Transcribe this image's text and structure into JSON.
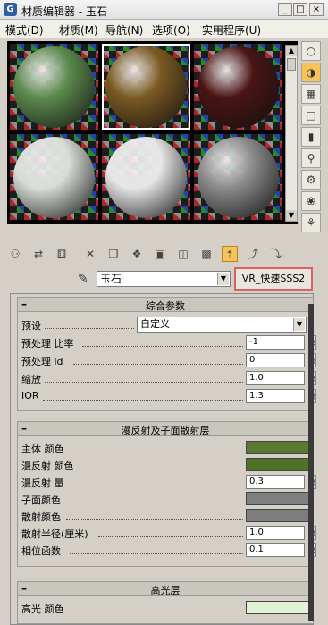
{
  "window": {
    "title": "材质编辑器 - 玉石",
    "controls": [
      "_",
      "□",
      "×"
    ]
  },
  "menu": [
    "模式(D)",
    "材质(M)",
    "导航(N)",
    "选项(O)",
    "实用程序(U)"
  ],
  "slots": [
    {
      "material": "green",
      "color": "#5c8a4e",
      "selected": false
    },
    {
      "material": "checker-glass",
      "color": "#7a5a22",
      "selected": true
    },
    {
      "material": "dark-red",
      "color": "#4a1414",
      "selected": false
    },
    {
      "material": "white-1",
      "color": "#d8ddd8",
      "selected": false
    },
    {
      "material": "white-2",
      "color": "#e6e6e6",
      "selected": false
    },
    {
      "material": "gray",
      "color": "#8a8a8a",
      "selected": false
    }
  ],
  "tools_right": [
    {
      "icon": "sample-type-icon",
      "glyph": "○",
      "active": false
    },
    {
      "icon": "backlight-icon",
      "glyph": "◑",
      "active": true
    },
    {
      "icon": "background-icon",
      "glyph": "▦",
      "active": false
    },
    {
      "icon": "uv-tiling-icon",
      "glyph": "□",
      "active": false
    },
    {
      "icon": "video-color-check-icon",
      "glyph": "▮",
      "active": false
    },
    {
      "icon": "make-preview-icon",
      "glyph": "⚲",
      "active": false
    },
    {
      "icon": "options-icon",
      "glyph": "⚙",
      "active": false
    },
    {
      "icon": "select-by-material-icon",
      "glyph": "❀",
      "active": false
    },
    {
      "icon": "material-navigator-icon",
      "glyph": "⚘",
      "active": false
    }
  ],
  "toolbar": [
    {
      "icon": "get-material-icon",
      "glyph": "⚇",
      "active": false
    },
    {
      "icon": "put-to-scene-icon",
      "glyph": "⇄",
      "active": false
    },
    {
      "icon": "assign-to-selection-icon",
      "glyph": "⚅",
      "active": false
    },
    {
      "icon": "reset-map-icon",
      "glyph": "✕",
      "active": false
    },
    {
      "icon": "copy-material-icon",
      "glyph": "❐",
      "active": false
    },
    {
      "icon": "make-unique-icon",
      "glyph": "❖",
      "active": false
    },
    {
      "icon": "put-to-library-icon",
      "glyph": "▣",
      "active": false
    },
    {
      "icon": "material-id-icon",
      "glyph": "◫",
      "active": false
    },
    {
      "icon": "show-map-icon",
      "glyph": "▩",
      "active": false
    },
    {
      "icon": "show-end-result-icon",
      "glyph": "⇡",
      "active": true
    },
    {
      "icon": "go-to-parent-icon",
      "glyph": "⤴",
      "active": false
    },
    {
      "icon": "go-forward-sibling-icon",
      "glyph": "⤵",
      "active": false
    }
  ],
  "material": {
    "name": "玉石",
    "type": "VR_快速SSS2"
  },
  "rollouts": {
    "general": {
      "collapse": "–",
      "title": "综合参数",
      "preset_label": "预设",
      "preset_value": "自定义",
      "prepass_rate_label": "预处理 比率",
      "prepass_rate": "-1",
      "prepass_id_label": "预处理 id",
      "prepass_id": "0",
      "scale_label": "缩放",
      "scale": "1.0",
      "ior_label": "IOR",
      "ior": "1.3"
    },
    "diffuse": {
      "collapse": "–",
      "title": "漫反射及子面散射层",
      "overall_color_label": "主体 颜色",
      "overall_color": "#5a7a30",
      "diffuse_color_label": "漫反射 颜色",
      "diffuse_color": "#4e7226",
      "diffuse_amount_label": "漫反射 量",
      "diffuse_amount": "0.3",
      "sub_surface_color_label": "子面颜色",
      "sub_surface_color": "#808080",
      "scatter_color_label": "散射颜色",
      "scatter_color": "#7e7e7e",
      "scatter_radius_label": "散射半径(厘米)",
      "scatter_radius": "1.0",
      "phase_function_label": "相位函数",
      "phase_function": "0.1"
    },
    "specular": {
      "collapse": "–",
      "title": "高光层",
      "specular_color_label": "高光 颜色",
      "specular_color": "#e4f2d6"
    }
  }
}
